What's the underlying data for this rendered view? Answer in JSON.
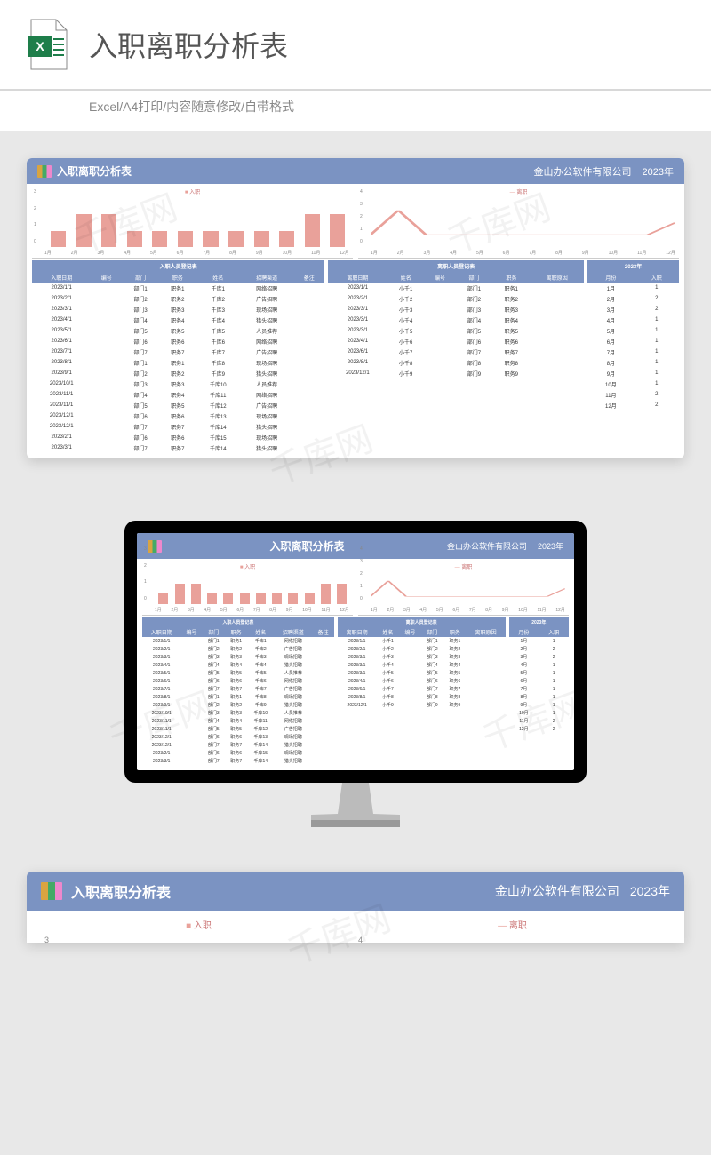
{
  "header": {
    "title": "入职离职分析表",
    "subtitle": "Excel/A4打印/内容随意修改/自带格式"
  },
  "sheet": {
    "title": "入职离职分析表",
    "company": "金山办公软件有限公司",
    "year": "2023年"
  },
  "chart_data": [
    {
      "type": "bar",
      "title": "入职",
      "categories": [
        "1月",
        "2月",
        "3月",
        "4月",
        "5月",
        "6月",
        "7月",
        "8月",
        "9月",
        "10月",
        "11月",
        "12月"
      ],
      "values": [
        1,
        2,
        2,
        1,
        1,
        1,
        1,
        1,
        1,
        1,
        2,
        2
      ],
      "ylim": [
        0,
        3
      ],
      "yticks": [
        0,
        1,
        2,
        3
      ]
    },
    {
      "type": "line",
      "title": "离职",
      "categories": [
        "1月",
        "2月",
        "3月",
        "4月",
        "5月",
        "6月",
        "7月",
        "8月",
        "9月",
        "10月",
        "11月",
        "12月"
      ],
      "values": [
        1,
        3,
        1,
        1,
        1,
        1,
        1,
        1,
        1,
        1,
        1,
        2
      ],
      "ylim": [
        0,
        4
      ],
      "yticks": [
        0,
        1,
        2,
        3,
        4
      ]
    }
  ],
  "tables": {
    "onboard": {
      "title": "入职人员登记表",
      "cols": [
        "入职日期",
        "编号",
        "部门",
        "职务",
        "姓名",
        "招聘渠道",
        "备注"
      ],
      "rows": [
        [
          "2023/1/1",
          "",
          "部门1",
          "职务1",
          "千库1",
          "网络招聘",
          ""
        ],
        [
          "2023/2/1",
          "",
          "部门2",
          "职务2",
          "千库2",
          "广告招聘",
          ""
        ],
        [
          "2023/3/1",
          "",
          "部门3",
          "职务3",
          "千库3",
          "现场招聘",
          ""
        ],
        [
          "2023/4/1",
          "",
          "部门4",
          "职务4",
          "千库4",
          "猎头招聘",
          ""
        ],
        [
          "2023/5/1",
          "",
          "部门5",
          "职务5",
          "千库5",
          "人员推荐",
          ""
        ],
        [
          "2023/6/1",
          "",
          "部门6",
          "职务6",
          "千库6",
          "网络招聘",
          ""
        ],
        [
          "2023/7/1",
          "",
          "部门7",
          "职务7",
          "千库7",
          "广告招聘",
          ""
        ],
        [
          "2023/8/1",
          "",
          "部门1",
          "职务1",
          "千库8",
          "现场招聘",
          ""
        ],
        [
          "2023/9/1",
          "",
          "部门2",
          "职务2",
          "千库9",
          "猎头招聘",
          ""
        ],
        [
          "2023/10/1",
          "",
          "部门3",
          "职务3",
          "千库10",
          "人员推荐",
          ""
        ],
        [
          "2023/11/1",
          "",
          "部门4",
          "职务4",
          "千库11",
          "网络招聘",
          ""
        ],
        [
          "2023/11/1",
          "",
          "部门5",
          "职务5",
          "千库12",
          "广告招聘",
          ""
        ],
        [
          "2023/12/1",
          "",
          "部门6",
          "职务6",
          "千库13",
          "现场招聘",
          ""
        ],
        [
          "2023/12/1",
          "",
          "部门7",
          "职务7",
          "千库14",
          "猎头招聘",
          ""
        ],
        [
          "2023/2/1",
          "",
          "部门6",
          "职务6",
          "千库15",
          "现场招聘",
          ""
        ],
        [
          "2023/3/1",
          "",
          "部门7",
          "职务7",
          "千库14",
          "猎头招聘",
          ""
        ]
      ]
    },
    "offboard": {
      "title": "离职人员登记表",
      "cols": [
        "离职日期",
        "姓名",
        "编号",
        "部门",
        "职务",
        "离职原因"
      ],
      "rows": [
        [
          "2023/1/1",
          "小千1",
          "",
          "部门1",
          "职务1",
          ""
        ],
        [
          "2023/2/1",
          "小千2",
          "",
          "部门2",
          "职务2",
          ""
        ],
        [
          "2023/3/1",
          "小千3",
          "",
          "部门3",
          "职务3",
          ""
        ],
        [
          "2023/3/1",
          "小千4",
          "",
          "部门4",
          "职务4",
          ""
        ],
        [
          "2023/3/1",
          "小千5",
          "",
          "部门5",
          "职务5",
          ""
        ],
        [
          "2023/4/1",
          "小千6",
          "",
          "部门6",
          "职务6",
          ""
        ],
        [
          "2023/6/1",
          "小千7",
          "",
          "部门7",
          "职务7",
          ""
        ],
        [
          "2023/8/1",
          "小千8",
          "",
          "部门8",
          "职务8",
          ""
        ],
        [
          "2023/12/1",
          "小千9",
          "",
          "部门9",
          "职务9",
          ""
        ]
      ]
    },
    "summary": {
      "title": "2023年",
      "cols": [
        "月份",
        "入职"
      ],
      "rows": [
        [
          "1月",
          "1"
        ],
        [
          "2月",
          "2"
        ],
        [
          "3月",
          "2"
        ],
        [
          "4月",
          "1"
        ],
        [
          "5月",
          "1"
        ],
        [
          "6月",
          "1"
        ],
        [
          "7月",
          "1"
        ],
        [
          "8月",
          "1"
        ],
        [
          "9月",
          "1"
        ],
        [
          "10月",
          "1"
        ],
        [
          "11月",
          "2"
        ],
        [
          "12月",
          "2"
        ]
      ]
    }
  },
  "watermark": "千库网"
}
